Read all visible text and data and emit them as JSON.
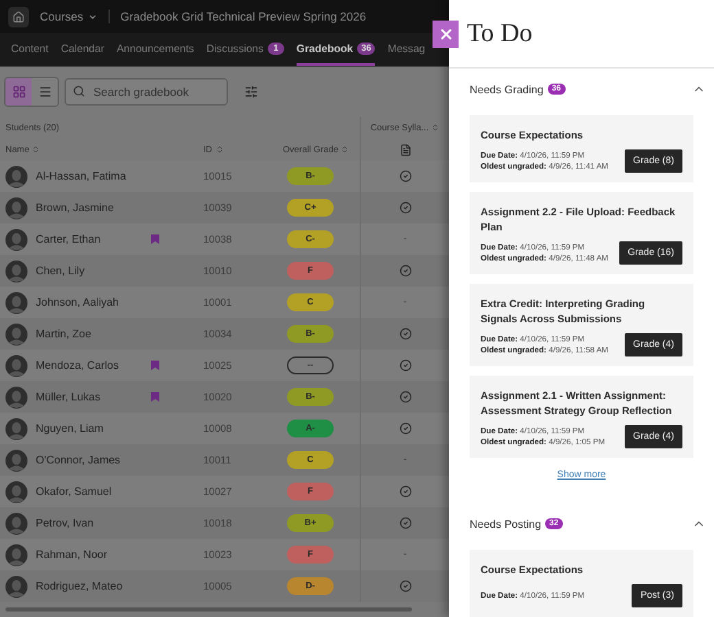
{
  "top_bar": {
    "courses_label": "Courses",
    "course_title": "Gradebook Grid Technical Preview Spring 2026"
  },
  "nav_tabs": [
    {
      "label": "Content",
      "selected": false
    },
    {
      "label": "Calendar",
      "selected": false
    },
    {
      "label": "Announcements",
      "selected": false
    },
    {
      "label": "Discussions",
      "badge": "1",
      "selected": false
    },
    {
      "label": "Gradebook",
      "badge": "36",
      "selected": true
    },
    {
      "label": "Messag",
      "selected": false
    }
  ],
  "toolbar": {
    "views": [
      {
        "kind": "grid",
        "selected": true
      },
      {
        "kind": "list",
        "selected": false
      }
    ],
    "search": {
      "placeholder": "Search gradebook"
    }
  },
  "gradebook": {
    "students_heading": "Students (20)",
    "columns": [
      "Name",
      "ID",
      "Overall Grade",
      "Course Sylla..."
    ],
    "rows": [
      {
        "name": "Al-Hassan, Fatima",
        "flagged": false,
        "id": "10015",
        "grade": "B-",
        "color": "#8e9a24",
        "syllabus": {
          "kind": "check"
        }
      },
      {
        "name": "Brown, Jasmine",
        "flagged": false,
        "id": "10039",
        "grade": "C+",
        "color": "#b3a126",
        "syllabus": {
          "kind": "check"
        }
      },
      {
        "name": "Carter, Ethan",
        "flagged": true,
        "id": "10038",
        "grade": "C-",
        "color": "#b3a126",
        "syllabus": {
          "kind": "dash",
          "text": "-"
        }
      },
      {
        "name": "Chen, Lily",
        "flagged": false,
        "id": "10010",
        "grade": "F",
        "color": "#c0605e",
        "syllabus": {
          "kind": "check"
        }
      },
      {
        "name": "Johnson, Aaliyah",
        "flagged": false,
        "id": "10001",
        "grade": "C",
        "color": "#b3a126",
        "syllabus": {
          "kind": "dash",
          "text": "-"
        }
      },
      {
        "name": "Martin, Zoe",
        "flagged": false,
        "id": "10034",
        "grade": "B-",
        "color": "#8e9a24",
        "syllabus": {
          "kind": "check"
        }
      },
      {
        "name": "Mendoza, Carlos",
        "flagged": true,
        "id": "10025",
        "grade": "--",
        "syllabus": {
          "kind": "check"
        }
      },
      {
        "name": "Müller, Lukas",
        "flagged": true,
        "id": "10020",
        "grade": "B-",
        "color": "#8e9a24",
        "syllabus": {
          "kind": "check"
        }
      },
      {
        "name": "Nguyen, Liam",
        "flagged": false,
        "id": "10008",
        "grade": "A-",
        "color": "#1f8f45",
        "syllabus": {
          "kind": "check"
        }
      },
      {
        "name": "O'Connor, James",
        "flagged": false,
        "id": "10011",
        "grade": "C",
        "color": "#b3a126",
        "syllabus": {
          "kind": "dash",
          "text": "-"
        }
      },
      {
        "name": "Okafor, Samuel",
        "flagged": false,
        "id": "10027",
        "grade": "F",
        "color": "#c0605e",
        "syllabus": {
          "kind": "check"
        }
      },
      {
        "name": "Petrov, Ivan",
        "flagged": false,
        "id": "10018",
        "grade": "B+",
        "color": "#8e9a24",
        "syllabus": {
          "kind": "check"
        }
      },
      {
        "name": "Rahman, Noor",
        "flagged": false,
        "id": "10023",
        "grade": "F",
        "color": "#c0605e",
        "syllabus": {
          "kind": "dash",
          "text": "-"
        }
      },
      {
        "name": "Rodriguez, Mateo",
        "flagged": false,
        "id": "10005",
        "grade": "D-",
        "color": "#b8862e",
        "syllabus": {
          "kind": "check"
        }
      }
    ]
  },
  "drawer": {
    "title": "To Do",
    "sections": [
      {
        "heading": "Needs Grading",
        "count": "36",
        "expanded": true,
        "items": [
          {
            "title": "Course Expectations",
            "details": [
              "**Due Date:** 4/10/26, 11:59 PM",
              "**Oldest ungraded:** 4/9/26, 11:41 AM"
            ],
            "action": "Grade (8)"
          },
          {
            "title": "Assignment 2.2 - File Upload: Feedback Plan",
            "details": [
              "**Due Date:** 4/10/26, 11:59 PM",
              "**Oldest ungraded:** 4/9/26, 11:48 AM"
            ],
            "action": "Grade (16)"
          },
          {
            "title": "Extra Credit: Interpreting Grading Signals Across Submissions",
            "details": [
              "**Due Date:** 4/10/26, 11:59 PM",
              "**Oldest ungraded:** 4/9/26, 11:58 AM"
            ],
            "action": "Grade (4)"
          },
          {
            "title": "Assignment 2.1 - Written Assignment: Assessment Strategy Group Reflection",
            "details": [
              "**Due Date:** 4/10/26, 11:59 PM",
              "**Oldest ungraded:** 4/9/26, 1:05 PM"
            ],
            "action": "Grade (4)"
          }
        ],
        "show_more": "Show more"
      },
      {
        "heading": "Needs Posting",
        "count": "32",
        "expanded": true,
        "items": [
          {
            "title": "Course Expectations",
            "details": [
              "**Due Date:** 4/10/26, 11:59 PM"
            ],
            "action": "Post (3)"
          }
        ]
      }
    ]
  }
}
